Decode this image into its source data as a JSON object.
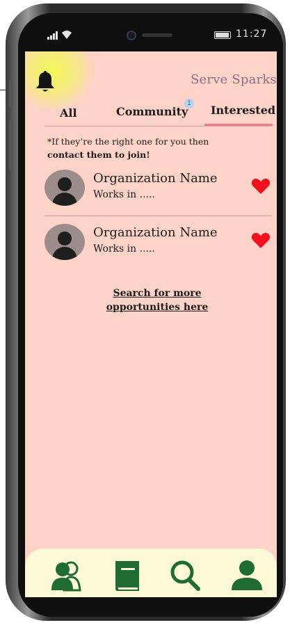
{
  "status_bar": {
    "time": "11:27"
  },
  "header": {
    "brand": "Serve Sparks",
    "icons": {
      "notification": "bell-icon"
    }
  },
  "tabs": [
    {
      "label": "All",
      "active": false
    },
    {
      "label": "Community",
      "active": false,
      "badge": "1"
    },
    {
      "label": "Interested",
      "active": true
    }
  ],
  "note": {
    "line1": "*If they’re the right one for you then",
    "line2": "contact them to join!"
  },
  "organizations": [
    {
      "name": "Organization Name",
      "subtitle": "Works in .....",
      "icon": "avatar-placeholder",
      "liked": true
    },
    {
      "name": "Organization Name",
      "subtitle": "Works in .....",
      "icon": "avatar-placeholder",
      "liked": true
    }
  ],
  "search_link": {
    "line1": "Search for more",
    "line2": "opportunities here"
  },
  "bottom_nav": {
    "items": [
      {
        "icon": "people-icon"
      },
      {
        "icon": "book-icon"
      },
      {
        "icon": "search-icon"
      },
      {
        "icon": "profile-icon"
      }
    ]
  },
  "colors": {
    "screen_bg": "#fdd3c7",
    "nav_bg": "#fbf9d6",
    "accent_green": "#1f6b33",
    "heart_red": "#f0101e",
    "active_tab_underline": "#ef7c85",
    "brand_text": "#8a6f88"
  }
}
